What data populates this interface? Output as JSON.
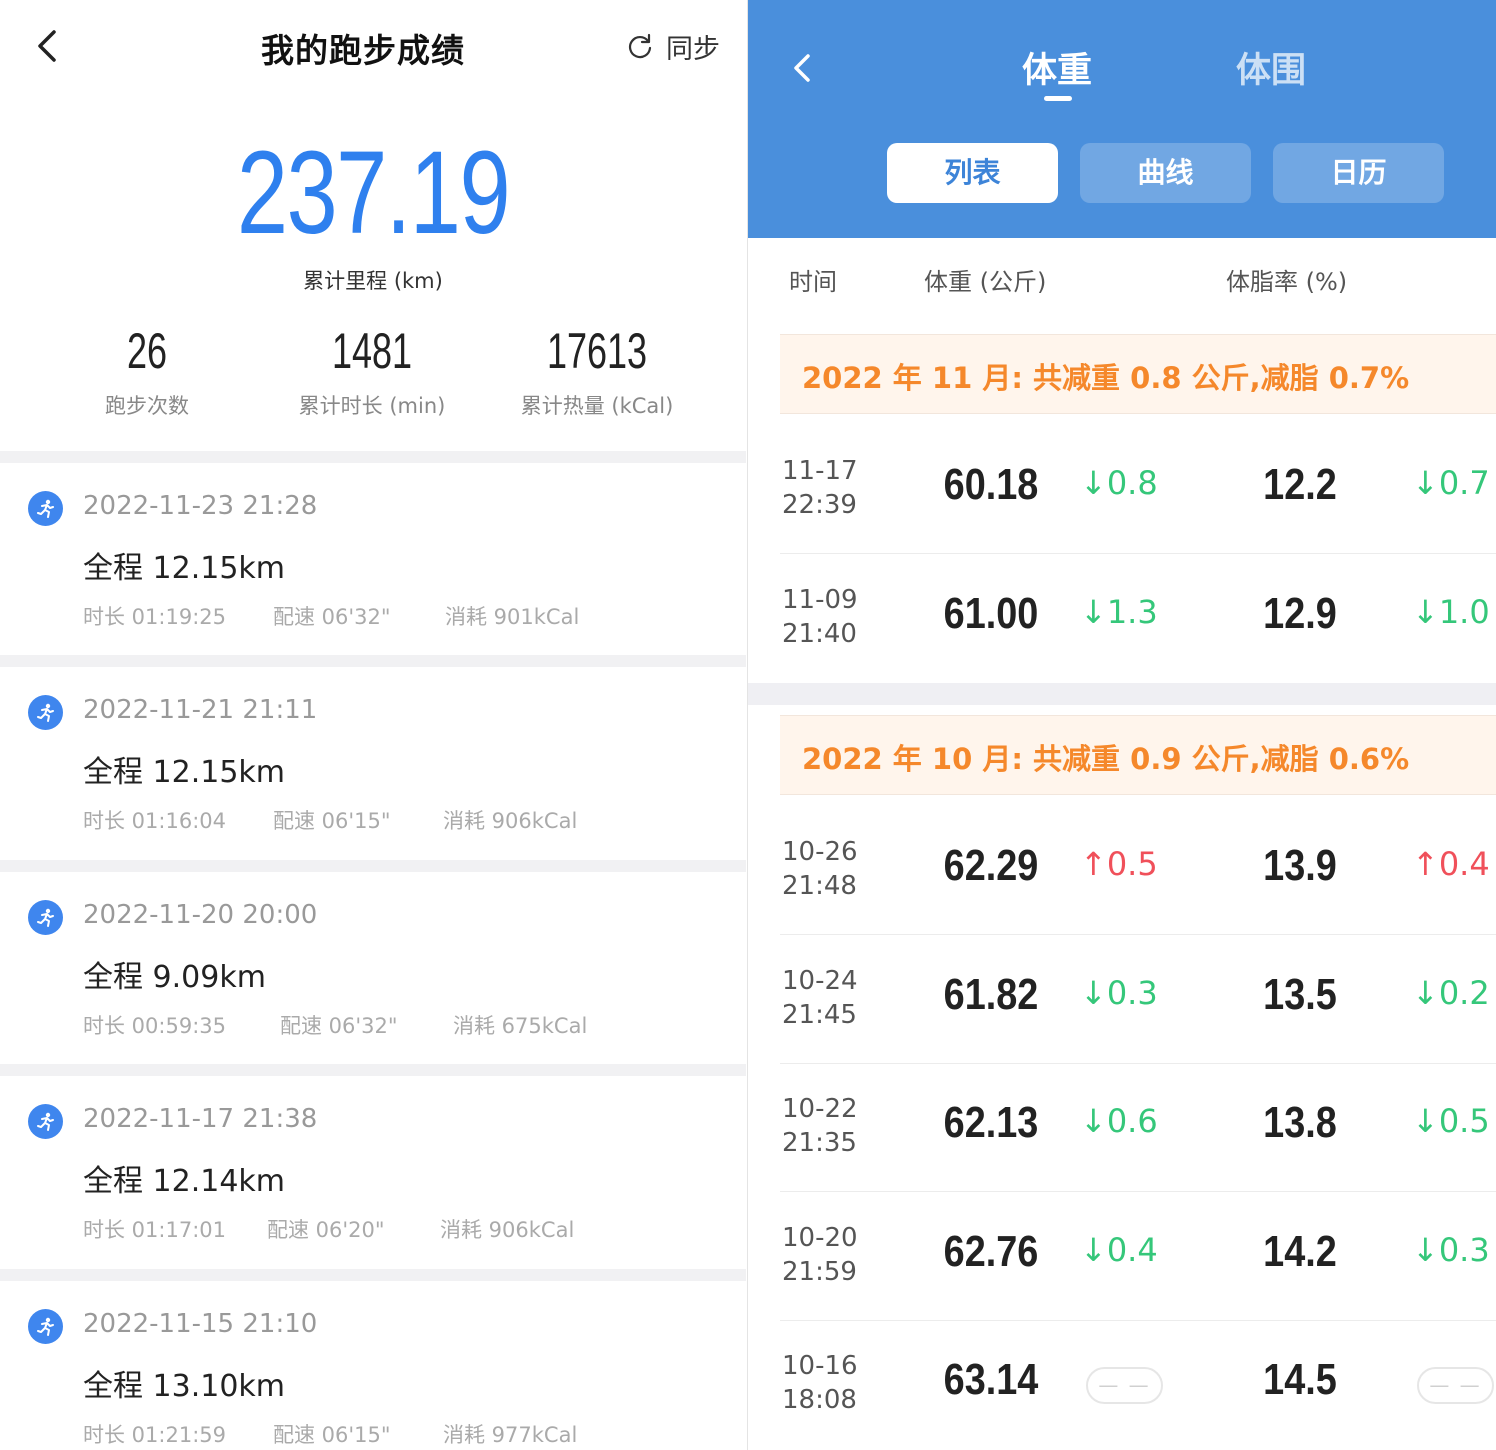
{
  "left": {
    "title": "我的跑步成绩",
    "sync_label": "同步",
    "total_km": "237.19",
    "total_label": "累计里程 (km)",
    "stats": [
      {
        "value": "26",
        "label": "跑步次数"
      },
      {
        "value": "1481",
        "label": "累计时长 (min)"
      },
      {
        "value": "17613",
        "label": "累计热量 (kCal)"
      }
    ],
    "runs": [
      {
        "date": "2022-11-23 21:28",
        "distance": "全程 12.15km",
        "duration": "时长 01:19:25",
        "pace": "配速 06'32\"",
        "calories": "消耗 901kCal"
      },
      {
        "date": "2022-11-21 21:11",
        "distance": "全程 12.15km",
        "duration": "时长 01:16:04",
        "pace": "配速 06'15\"",
        "calories": "消耗 906kCal"
      },
      {
        "date": "2022-11-20 20:00",
        "distance": "全程 9.09km",
        "duration": "时长 00:59:35",
        "pace": "配速 06'32\"",
        "calories": "消耗 675kCal"
      },
      {
        "date": "2022-11-17 21:38",
        "distance": "全程 12.14km",
        "duration": "时长 01:17:01",
        "pace": "配速 06'20\"",
        "calories": "消耗 906kCal"
      },
      {
        "date": "2022-11-15 21:10",
        "distance": "全程 13.10km",
        "duration": "时长 01:21:59",
        "pace": "配速 06'15\"",
        "calories": "消耗 977kCal"
      }
    ]
  },
  "right": {
    "tabs": [
      {
        "label": "体重",
        "active": true
      },
      {
        "label": "体围",
        "active": false
      }
    ],
    "segments": [
      {
        "label": "列表",
        "active": true
      },
      {
        "label": "曲线",
        "active": false
      },
      {
        "label": "日历",
        "active": false
      }
    ],
    "columns": {
      "time": "时间",
      "weight": "体重 (公斤)",
      "fat": "体脂率 (%)"
    },
    "months": [
      {
        "summary": "2022 年 11 月: 共减重 0.8 公斤,减脂 0.7%",
        "rows": [
          {
            "date": "11-17",
            "time": "22:39",
            "weight": "60.18",
            "weight_delta": "↓0.8",
            "weight_dir": "down",
            "fat": "12.2",
            "fat_delta": "↓0.7",
            "fat_dir": "down"
          },
          {
            "date": "11-09",
            "time": "21:40",
            "weight": "61.00",
            "weight_delta": "↓1.3",
            "weight_dir": "down",
            "fat": "12.9",
            "fat_delta": "↓1.0",
            "fat_dir": "down"
          }
        ]
      },
      {
        "summary": "2022 年 10 月: 共减重 0.9 公斤,减脂 0.6%",
        "rows": [
          {
            "date": "10-26",
            "time": "21:48",
            "weight": "62.29",
            "weight_delta": "↑0.5",
            "weight_dir": "up",
            "fat": "13.9",
            "fat_delta": "↑0.4",
            "fat_dir": "up"
          },
          {
            "date": "10-24",
            "time": "21:45",
            "weight": "61.82",
            "weight_delta": "↓0.3",
            "weight_dir": "down",
            "fat": "13.5",
            "fat_delta": "↓0.2",
            "fat_dir": "down"
          },
          {
            "date": "10-22",
            "time": "21:35",
            "weight": "62.13",
            "weight_delta": "↓0.6",
            "weight_dir": "down",
            "fat": "13.8",
            "fat_delta": "↓0.5",
            "fat_dir": "down"
          },
          {
            "date": "10-20",
            "time": "21:59",
            "weight": "62.76",
            "weight_delta": "↓0.4",
            "weight_dir": "down",
            "fat": "14.2",
            "fat_delta": "↓0.3",
            "fat_dir": "down"
          },
          {
            "date": "10-16",
            "time": "18:08",
            "weight": "63.14",
            "weight_delta": "— —",
            "weight_dir": "none",
            "fat": "14.5",
            "fat_delta": "— —",
            "fat_dir": "none"
          }
        ]
      }
    ]
  },
  "colors": {
    "accent_blue": "#2f80ee",
    "header_blue": "#4a8fdc",
    "down_green": "#35c77a",
    "up_red": "#f0505a",
    "summary_orange": "#f5882b"
  }
}
